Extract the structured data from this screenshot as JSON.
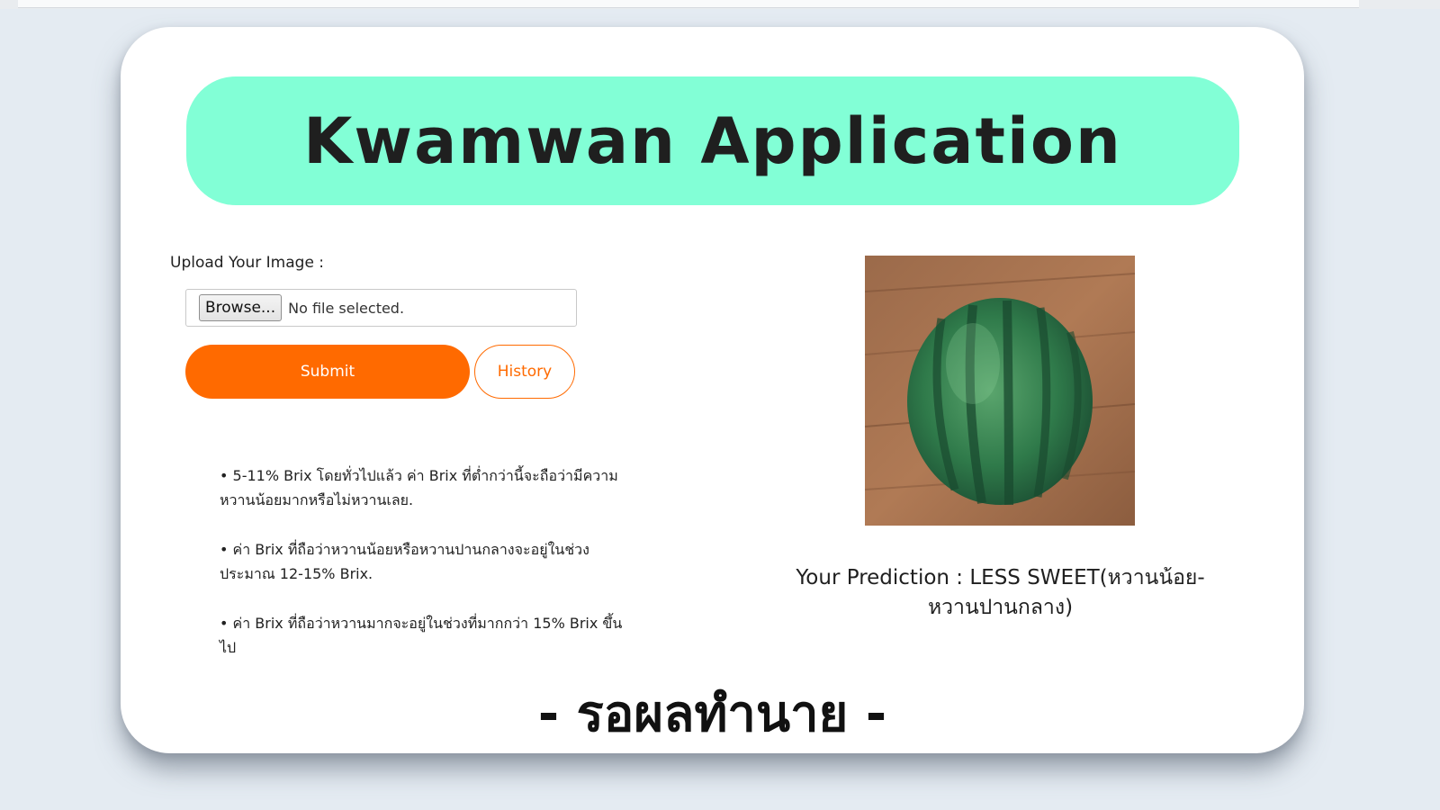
{
  "app": {
    "title": "Kwamwan Application"
  },
  "upload": {
    "label": "Upload Your Image :",
    "browse_label": "Browse...",
    "file_status": "No file selected."
  },
  "actions": {
    "submit_label": "Submit",
    "history_label": "History"
  },
  "info": {
    "items": [
      "• 5-11% Brix โดยทั่วไปแล้ว ค่า Brix ที่ต่ำกว่านี้จะถือว่ามีความหวานน้อยมากหรือไม่หวานเลย.",
      "• ค่า Brix ที่ถือว่าหวานน้อยหรือหวานปานกลางจะอยู่ในช่วงประมาณ 12-15% Brix.",
      "• ค่า Brix ที่ถือว่าหวานมากจะอยู่ในช่วงที่มากกว่า 15% Brix ขึ้นไป"
    ]
  },
  "result": {
    "prediction_text": "Your Prediction : LESS SWEET(หวานน้อย-หวานปานกลาง)",
    "waiting_text": "- รอผลทำนาย -"
  },
  "colors": {
    "header_bg": "#82ffd6",
    "accent": "#ff6a00",
    "page_bg": "#e4ebf2"
  }
}
